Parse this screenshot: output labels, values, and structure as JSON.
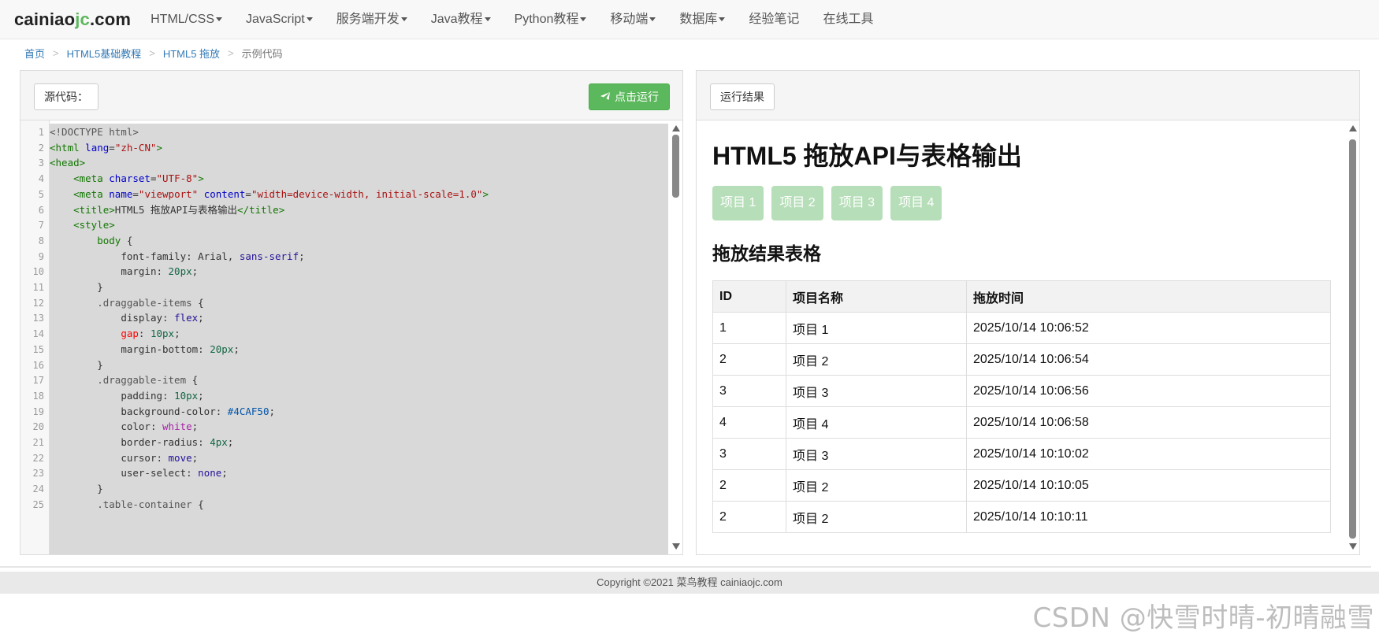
{
  "navbar": {
    "brand_prefix": "cainiao",
    "brand_accent": "jc",
    "brand_suffix": ".com",
    "items": [
      {
        "label": "HTML/CSS",
        "dropdown": true
      },
      {
        "label": "JavaScript",
        "dropdown": true
      },
      {
        "label": "服务端开发",
        "dropdown": true
      },
      {
        "label": "Java教程",
        "dropdown": true
      },
      {
        "label": "Python教程",
        "dropdown": true
      },
      {
        "label": "移动端",
        "dropdown": true
      },
      {
        "label": "数据库",
        "dropdown": true
      },
      {
        "label": "经验笔记",
        "dropdown": false
      },
      {
        "label": "在线工具",
        "dropdown": false
      }
    ]
  },
  "breadcrumb": {
    "home": "首页",
    "section": "HTML5基础教程",
    "page": "HTML5 拖放",
    "current": "示例代码",
    "separator": ">"
  },
  "source_panel": {
    "label": "源代码：",
    "run_button": "点击运行",
    "scroll_position": 0.0
  },
  "code_lines": [
    [
      "1",
      "<!DOCTYPE html>"
    ],
    [
      "2",
      "<html lang=\"zh-CN\">"
    ],
    [
      "3",
      "<head>"
    ],
    [
      "4",
      "    <meta charset=\"UTF-8\">"
    ],
    [
      "5",
      "    <meta name=\"viewport\" content=\"width=device-width, initial-scale=1.0\">"
    ],
    [
      "6",
      "    <title>HTML5 拖放API与表格输出</title>"
    ],
    [
      "7",
      "    <style>"
    ],
    [
      "8",
      "        body {"
    ],
    [
      "9",
      "            font-family: Arial, sans-serif;"
    ],
    [
      "10",
      "            margin: 20px;"
    ],
    [
      "11",
      "        }"
    ],
    [
      "12",
      "        .draggable-items {"
    ],
    [
      "13",
      "            display: flex;"
    ],
    [
      "14",
      "            gap: 10px;"
    ],
    [
      "15",
      "            margin-bottom: 20px;"
    ],
    [
      "16",
      "        }"
    ],
    [
      "17",
      "        .draggable-item {"
    ],
    [
      "18",
      "            padding: 10px;"
    ],
    [
      "19",
      "            background-color: #4CAF50;"
    ],
    [
      "20",
      "            color: white;"
    ],
    [
      "21",
      "            border-radius: 4px;"
    ],
    [
      "22",
      "            cursor: move;"
    ],
    [
      "23",
      "            user-select: none;"
    ],
    [
      "24",
      "        }"
    ],
    [
      "25",
      "        .table-container {"
    ]
  ],
  "result_panel": {
    "label": "运行结果",
    "title": "HTML5 拖放API与表格输出",
    "chips": [
      "项目 1",
      "项目 2",
      "项目 3",
      "项目 4"
    ],
    "chip_color": "#4CAF50",
    "subtitle": "拖放结果表格",
    "table": {
      "headers": [
        "ID",
        "项目名称",
        "拖放时间"
      ],
      "rows": [
        [
          "1",
          "项目 1",
          "2025/10/14 10:06:52"
        ],
        [
          "2",
          "项目 2",
          "2025/10/14 10:06:54"
        ],
        [
          "3",
          "项目 3",
          "2025/10/14 10:06:56"
        ],
        [
          "4",
          "项目 4",
          "2025/10/14 10:06:58"
        ],
        [
          "3",
          "项目 3",
          "2025/10/14 10:10:02"
        ],
        [
          "2",
          "项目 2",
          "2025/10/14 10:10:05"
        ],
        [
          "2",
          "项目 2",
          "2025/10/14 10:10:11"
        ]
      ]
    }
  },
  "footer": {
    "copyright": "Copyright ©2021 菜鸟教程 cainiaojc.com"
  },
  "watermark": "CSDN @快雪时晴-初晴融雪",
  "colors": {
    "run_button": "#5cb85c",
    "link": "#337ab7",
    "brand_accent": "#5cb85c"
  }
}
